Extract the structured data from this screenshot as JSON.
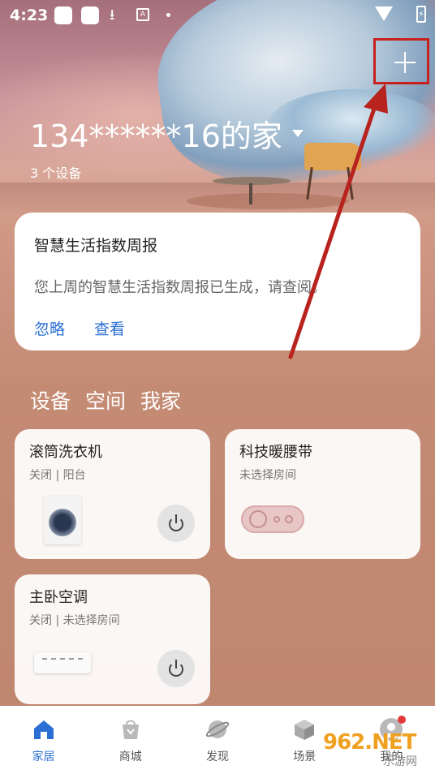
{
  "status_bar": {
    "time": "4:23",
    "battery": "⚡"
  },
  "header": {
    "home_name": "134******16的家",
    "device_count": "3 个设备"
  },
  "report_card": {
    "title": "智慧生活指数周报",
    "description": "您上周的智慧生活指数周报已生成，请查阅。",
    "ignore_label": "忽略",
    "view_label": "查看"
  },
  "section_tabs": [
    "设备",
    "空间",
    "我家"
  ],
  "devices": [
    {
      "name": "滚筒洗衣机",
      "status": "关闭 | 阳台",
      "icon": "washing-machine"
    },
    {
      "name": "科技暖腰带",
      "status": "未选择房间",
      "icon": "waist-belt"
    },
    {
      "name": "主卧空调",
      "status": "关闭 | 未选择房间",
      "icon": "air-conditioner"
    }
  ],
  "bottom_nav": [
    {
      "label": "家居",
      "icon": "home-icon",
      "active": true
    },
    {
      "label": "商城",
      "icon": "shopping-bag-icon",
      "active": false
    },
    {
      "label": "发现",
      "icon": "planet-icon",
      "active": false
    },
    {
      "label": "场景",
      "icon": "cube-icon",
      "active": false
    },
    {
      "label": "我的",
      "icon": "profile-icon",
      "active": false
    }
  ],
  "watermark": {
    "brand": "962.NET",
    "caption": "乐游网"
  },
  "colors": {
    "accent": "#2a6fd3",
    "highlight_box": "#c8211c",
    "notification_dot": "#e23a3a"
  }
}
